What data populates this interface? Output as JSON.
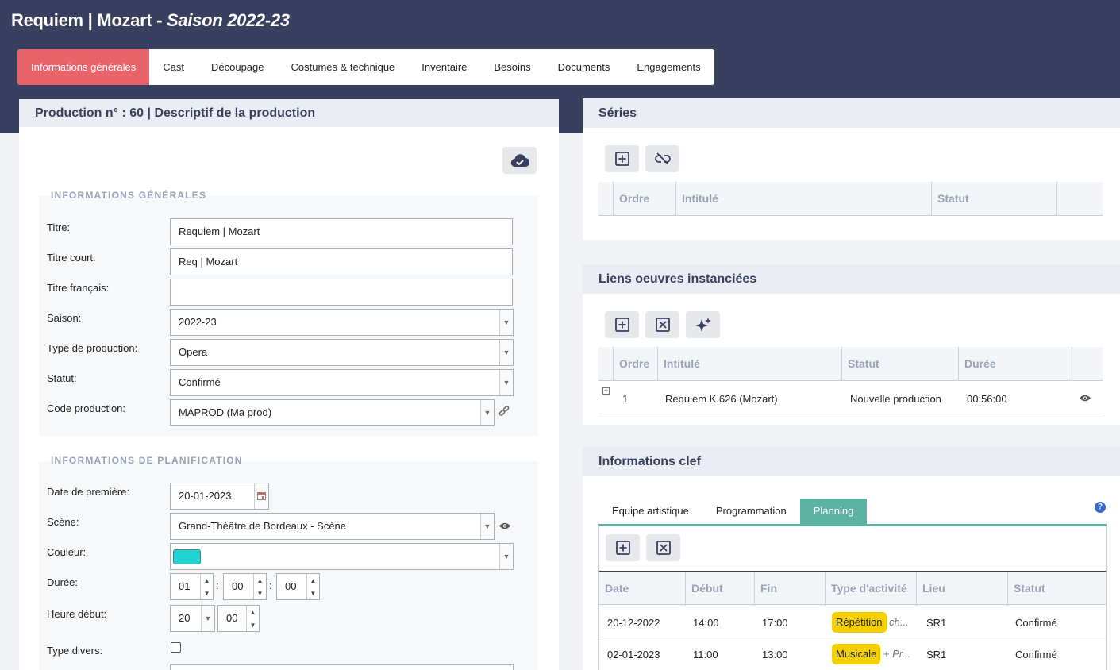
{
  "header": {
    "title": "Requiem | Mozart",
    "separator": " - ",
    "season": "Saison 2022-23"
  },
  "tabs": [
    "Informations générales",
    "Cast",
    "Découpage",
    "Costumes & technique",
    "Inventaire",
    "Besoins",
    "Documents",
    "Engagements"
  ],
  "production_panel": {
    "title": "Production n° : 60 | Descriptif de la production",
    "general_section": "INFORMATIONS GÉNÉRALES",
    "fields": {
      "titre": {
        "label": "Titre:",
        "value": "Requiem | Mozart"
      },
      "titre_court": {
        "label": "Titre court:",
        "value": "Req | Mozart"
      },
      "titre_francais": {
        "label": "Titre français:",
        "value": ""
      },
      "saison": {
        "label": "Saison:",
        "value": "2022-23"
      },
      "type_production": {
        "label": "Type de production:",
        "value": "Opera"
      },
      "statut": {
        "label": "Statut:",
        "value": "Confirmé"
      },
      "code_production": {
        "label": "Code production:",
        "value": "MAPROD (Ma prod)"
      }
    },
    "planning_section": "INFORMATIONS DE PLANIFICATION",
    "planning": {
      "date_premiere": {
        "label": "Date de première:",
        "value": "20-01-2023"
      },
      "scene": {
        "label": "Scène:",
        "value": "Grand-Théâtre de Bordeaux - Scène"
      },
      "couleur": {
        "label": "Couleur:",
        "value": "#22d3d3"
      },
      "duree": {
        "label": "Durée:",
        "h": "01",
        "m": "00",
        "s": "00"
      },
      "heure_debut": {
        "label": "Heure début:",
        "h": "20",
        "m": "00"
      },
      "type_divers": {
        "label": "Type divers:"
      }
    },
    "colon": ":"
  },
  "series_panel": {
    "title": "Séries",
    "columns": [
      "Ordre",
      "Intitulé",
      "Statut"
    ]
  },
  "liens_panel": {
    "title": "Liens oeuvres instanciées",
    "columns": [
      "Ordre",
      "Intitulé",
      "Statut",
      "Durée"
    ],
    "rows": [
      {
        "ordre": "1",
        "intitule": "Requiem K.626 (Mozart)",
        "statut": "Nouvelle production",
        "duree": "00:56:00"
      }
    ]
  },
  "key_panel": {
    "title": "Informations clef",
    "tabs": [
      "Equipe artistique",
      "Programmation",
      "Planning"
    ],
    "columns": [
      "Date",
      "Début",
      "Fin",
      "Type d'activité",
      "Lieu",
      "Statut"
    ],
    "rows": [
      {
        "date": "20-12-2022",
        "debut": "14:00",
        "fin": "17:00",
        "type": "Répétition",
        "extra": "ch...",
        "lieu": "SR1",
        "statut": "Confirmé"
      },
      {
        "date": "02-01-2023",
        "debut": "11:00",
        "fin": "13:00",
        "type": "Musicale",
        "extra": "+ Pr...",
        "lieu": "SR1",
        "statut": "Confirmé"
      }
    ]
  },
  "colors": {
    "header_bg": "#383f5f",
    "active_tab": "#e9636b",
    "planning_tab": "#5db3a1",
    "badge": "#f5d000"
  }
}
